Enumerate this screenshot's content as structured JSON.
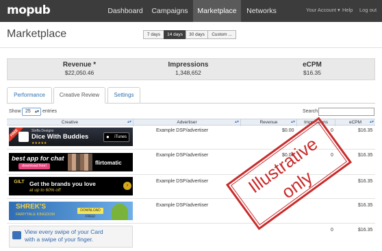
{
  "app": {
    "logo": "mopub",
    "nav": [
      "Dashboard",
      "Campaigns",
      "Marketplace",
      "Networks"
    ],
    "nav_active": "Marketplace",
    "account": "Your Account ▾",
    "help": "Help",
    "logout": "Log out"
  },
  "header": {
    "title": "Marketplace",
    "date_ranges": [
      "7 days",
      "14 days",
      "30 days",
      "Custom ..."
    ],
    "date_active": "14 days"
  },
  "stats": [
    {
      "label": "Revenue *",
      "value": "$22,050.46"
    },
    {
      "label": "Impressions",
      "value": "1,348,652"
    },
    {
      "label": "eCPM",
      "value": "$16.35"
    }
  ],
  "tabs": [
    "Performance",
    "Creative Review",
    "Settings"
  ],
  "tab_active": "Creative Review",
  "controls": {
    "show_label": "Show",
    "show_value": "25",
    "entries_label": "entries",
    "search_label": "Search:"
  },
  "table": {
    "columns": [
      "Creative",
      "Advertiser",
      "Revenue",
      "Impressions",
      "eCPM"
    ],
    "rows": [
      {
        "advertiser": "Example DSP/advertiser",
        "revenue": "$0.00",
        "impressions": "0",
        "ecpm": "$16.35"
      },
      {
        "advertiser": "Example DSP/advertiser",
        "revenue": "$0.00",
        "impressions": "0",
        "ecpm": "$16.35"
      },
      {
        "advertiser": "Example DSP/advertiser",
        "revenue": "",
        "impressions": "",
        "ecpm": "$16.35"
      },
      {
        "advertiser": "Example DSP/advertiser",
        "revenue": "",
        "impressions": "",
        "ecpm": "$16.35"
      },
      {
        "advertiser": "",
        "revenue": "",
        "impressions": "0",
        "ecpm": "$16.35"
      }
    ]
  },
  "banners": {
    "b1": {
      "badge": "FREE",
      "studio": "Stoffa Designs",
      "title": "Dice With Buddies",
      "stars": "★★★★★",
      "store": "iTunes"
    },
    "b2": {
      "title": "best app for chat",
      "button": "download free!",
      "brand": "flirtomatic"
    },
    "b3": {
      "logo": "GILT",
      "title": "Get the brands you love",
      "sub": "at up to 60% off",
      "arrow": "›"
    },
    "b4": {
      "title": "SHREK'S",
      "sub": "FAIRYTALE KINGDOM",
      "button": "DOWNLOAD FREE!"
    },
    "b5": {
      "line1": "View every swipe of your Card",
      "line2": "with a swipe of your finger."
    }
  },
  "stamp": {
    "line1": "Illustrative",
    "line2": "only"
  },
  "colors": {
    "nav_bg": "#3c3c3c",
    "link": "#2a6fb0",
    "stamp": "#c92b2b"
  }
}
